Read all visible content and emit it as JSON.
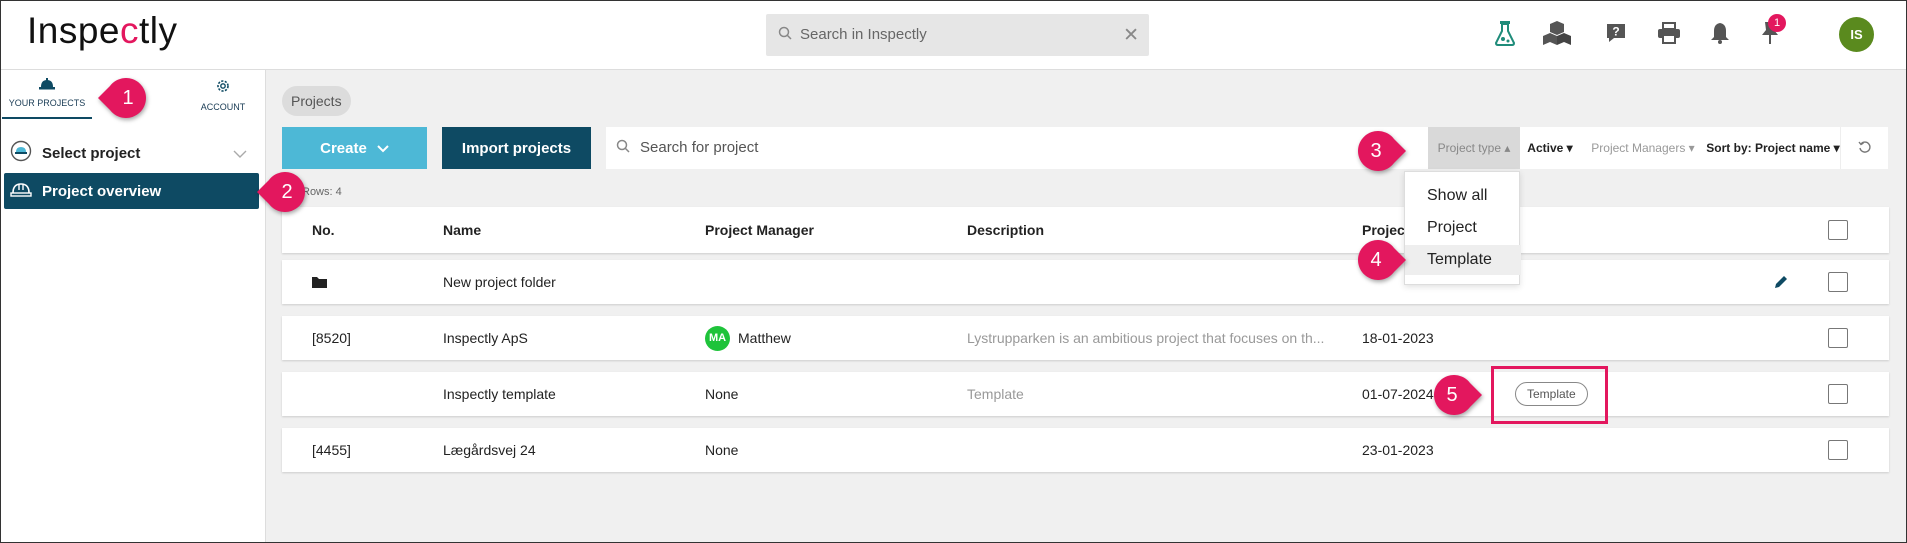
{
  "app": {
    "logo": "Inspectly"
  },
  "topbar": {
    "search_placeholder": "Search in Inspectly",
    "icons": [
      "flask-icon",
      "cubes-icon",
      "help-icon",
      "print-icon",
      "bell-icon",
      "pin-icon"
    ],
    "notification_count": "1",
    "user_initials": "IS"
  },
  "sidebar": {
    "tabs": [
      {
        "label": "YOUR PROJECTS",
        "icon": "helmet-icon"
      },
      {
        "label": "ACCOUNT",
        "icon": "gear-icon"
      }
    ],
    "select_project": "Select project",
    "project_overview": "Project overview"
  },
  "main": {
    "breadcrumb": "Projects",
    "create_label": "Create",
    "import_label": "Import projects",
    "search_placeholder": "Search for project",
    "filters": {
      "project_type": "Project type",
      "active": "Active",
      "project_managers": "Project Managers",
      "sort": "Sort by: Project name"
    },
    "rows_count": "Rows: 4",
    "dropdown_options": [
      "Show all",
      "Project",
      "Template"
    ],
    "table": {
      "headers": {
        "no": "No.",
        "name": "Name",
        "manager": "Project Manager",
        "description": "Description",
        "date": "Project"
      },
      "rows": [
        {
          "no": "",
          "name": "New project folder",
          "manager": "",
          "manager_initials": "",
          "description": "",
          "date": ""
        },
        {
          "no": "[8520]",
          "name": "Inspectly ApS",
          "manager": "Matthew",
          "manager_initials": "MA",
          "description": "Lystrupparken is an ambitious project that focuses on th...",
          "date": "18-01-2023"
        },
        {
          "no": "",
          "name": "Inspectly template",
          "manager": "None",
          "manager_initials": "",
          "description": "Template",
          "date": "01-07-2024",
          "badge": "Template"
        },
        {
          "no": "[4455]",
          "name": "Lægårdsvej 24",
          "manager": "None",
          "manager_initials": "",
          "description": "",
          "date": "23-01-2023"
        }
      ]
    }
  },
  "callouts": [
    "1",
    "2",
    "3",
    "4",
    "5"
  ],
  "colors": {
    "brand_dark": "#0e4a63",
    "brand_light": "#4db8d6",
    "accent": "#e3175e"
  }
}
